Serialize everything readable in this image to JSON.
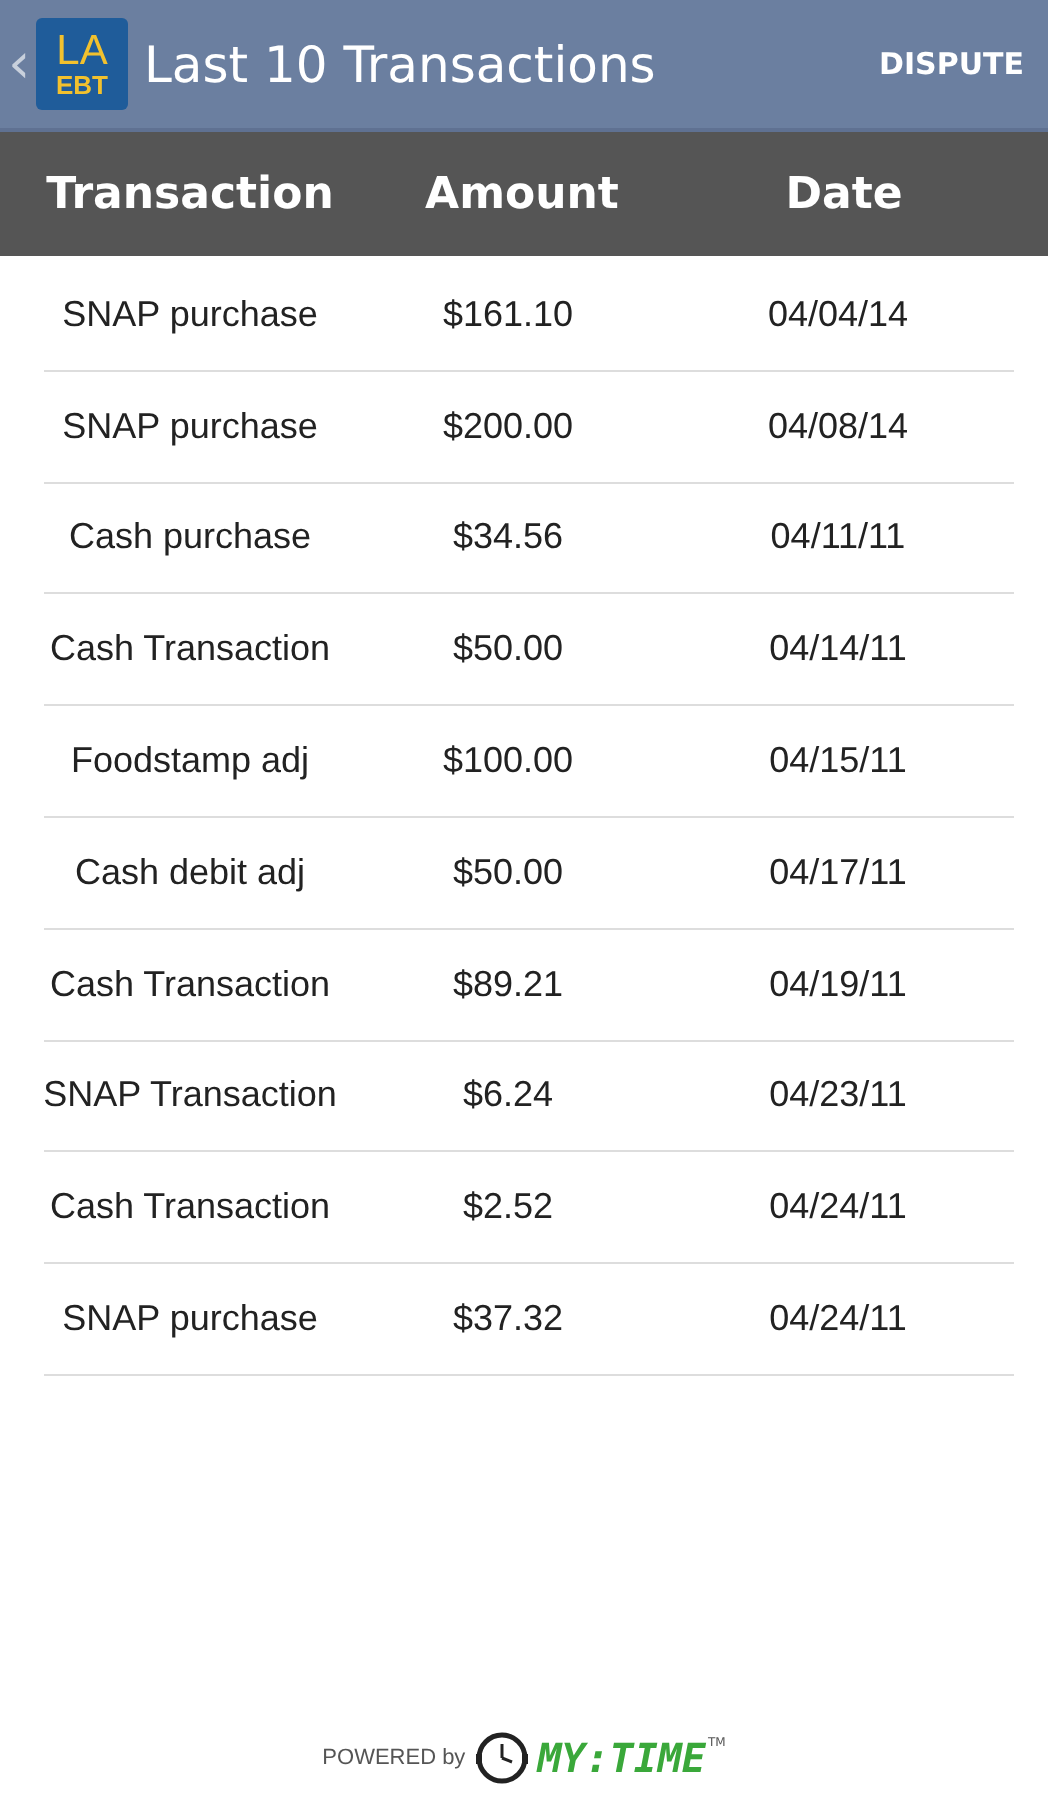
{
  "app_bar": {
    "back": "‹",
    "logo": {
      "top": "LA",
      "bottom": "EBT"
    },
    "title": "Last 10 Transactions",
    "action": "DISPUTE"
  },
  "table": {
    "columns": [
      "Transaction",
      "Amount",
      "Date"
    ],
    "rows": [
      {
        "transaction": "SNAP purchase",
        "amount": "$161.10",
        "date": "04/04/14"
      },
      {
        "transaction": "SNAP purchase",
        "amount": "$200.00",
        "date": "04/08/14"
      },
      {
        "transaction": "Cash purchase",
        "amount": "$34.56",
        "date": "04/11/11"
      },
      {
        "transaction": "Cash Transaction",
        "amount": "$50.00",
        "date": "04/14/11"
      },
      {
        "transaction": "Foodstamp adj",
        "amount": "$100.00",
        "date": "04/15/11"
      },
      {
        "transaction": "Cash debit adj",
        "amount": "$50.00",
        "date": "04/17/11"
      },
      {
        "transaction": "Cash Transaction",
        "amount": "$89.21",
        "date": "04/19/11"
      },
      {
        "transaction": "SNAP Transaction",
        "amount": "$6.24",
        "date": "04/23/11"
      },
      {
        "transaction": "Cash Transaction",
        "amount": "$2.52",
        "date": "04/24/11"
      },
      {
        "transaction": "SNAP purchase",
        "amount": "$37.32",
        "date": "04/24/11"
      }
    ]
  },
  "footer": {
    "powered_by": "POWERED by",
    "brand": "MY:TIME",
    "trademark": "TM"
  }
}
